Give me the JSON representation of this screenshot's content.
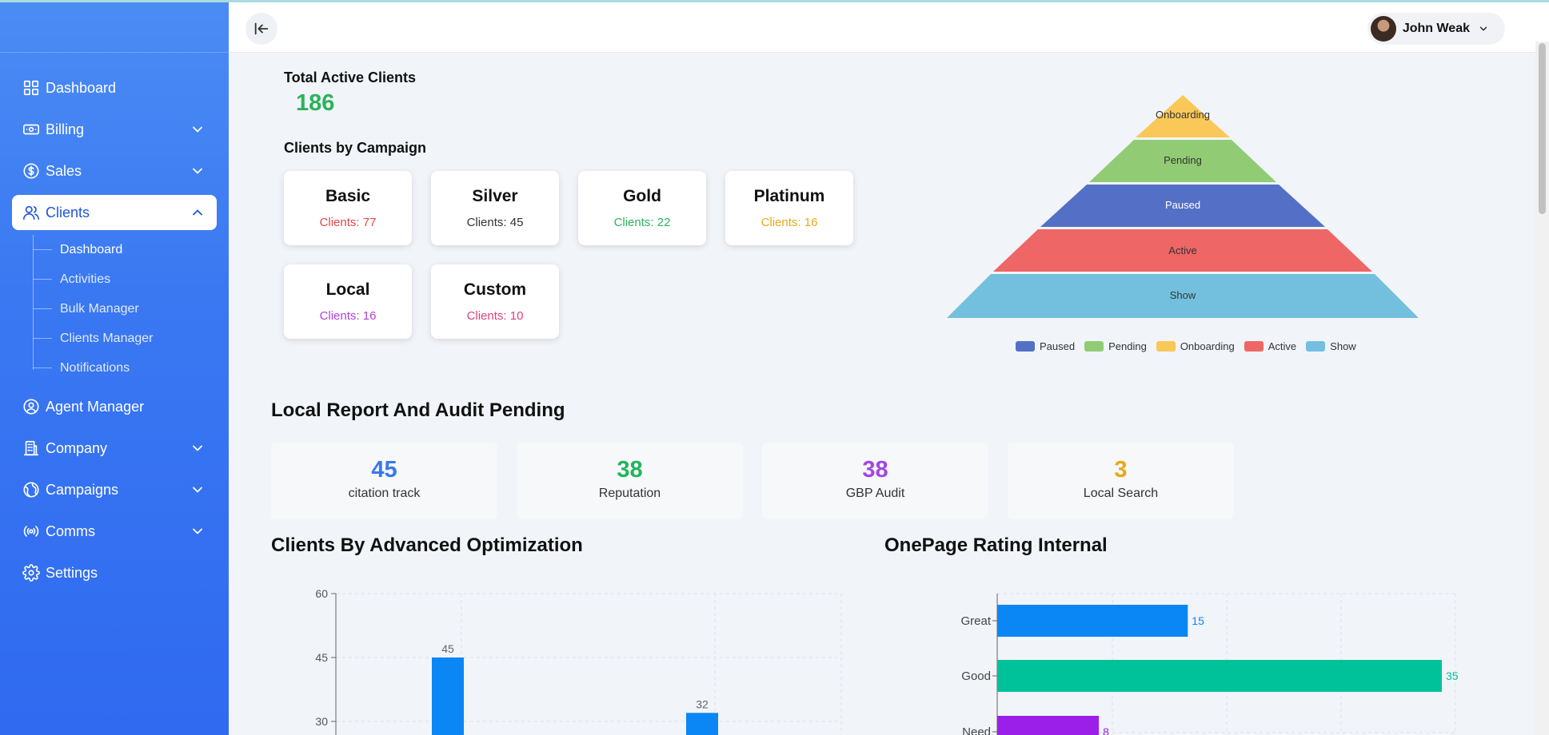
{
  "sidebar": {
    "items": [
      {
        "label": "Dashboard",
        "icon": "grid-icon",
        "expandable": false
      },
      {
        "label": "Billing",
        "icon": "cash-icon",
        "expandable": true
      },
      {
        "label": "Sales",
        "icon": "dollar-circle-icon",
        "expandable": true
      },
      {
        "label": "Clients",
        "icon": "users-icon",
        "expandable": true,
        "active": true
      },
      {
        "label": "Agent Manager",
        "icon": "user-circle-icon",
        "expandable": false
      },
      {
        "label": "Company",
        "icon": "building-icon",
        "expandable": true
      },
      {
        "label": "Campaigns",
        "icon": "globe-icon",
        "expandable": true
      },
      {
        "label": "Comms",
        "icon": "broadcast-icon",
        "expandable": true
      },
      {
        "label": "Settings",
        "icon": "gear-icon",
        "expandable": false
      }
    ],
    "clients_sub": [
      "Dashboard",
      "Activities",
      "Bulk Manager",
      "Clients Manager",
      "Notifications"
    ]
  },
  "header": {
    "user_name": "John Weak"
  },
  "summary": {
    "total_label": "Total Active Clients",
    "total_value": "186",
    "campaign_label": "Clients by Campaign"
  },
  "campaigns": [
    {
      "name": "Basic",
      "count": "Clients: 77",
      "color": "#e04848"
    },
    {
      "name": "Silver",
      "count": "Clients: 45",
      "color": "#333333"
    },
    {
      "name": "Gold",
      "count": "Clients: 22",
      "color": "#2bb35b"
    },
    {
      "name": "Platinum",
      "count": "Clients: 16",
      "color": "#e8a818"
    },
    {
      "name": "Local",
      "count": "Clients: 16",
      "color": "#b140d8"
    },
    {
      "name": "Custom",
      "count": "Clients: 10",
      "color": "#e0407c"
    }
  ],
  "pyramid": {
    "levels": [
      "Onboarding",
      "Pending",
      "Paused",
      "Active",
      "Show"
    ],
    "legend": [
      {
        "label": "Paused",
        "color": "#5470c6"
      },
      {
        "label": "Pending",
        "color": "#91cc75"
      },
      {
        "label": "Onboarding",
        "color": "#fac858"
      },
      {
        "label": "Active",
        "color": "#ee6666"
      },
      {
        "label": "Show",
        "color": "#73c0de"
      }
    ]
  },
  "local_report": {
    "title": "Local Report And Audit Pending",
    "stats": [
      {
        "value": "45",
        "label": "citation track",
        "color": "#3a78ea"
      },
      {
        "value": "38",
        "label": "Reputation",
        "color": "#22b55a"
      },
      {
        "value": "38",
        "label": "GBP Audit",
        "color": "#a246e6"
      },
      {
        "value": "3",
        "label": "Local Search",
        "color": "#e8a818"
      }
    ]
  },
  "adv_opt": {
    "title": "Clients By Advanced Optimization"
  },
  "onepage": {
    "title": "OnePage Rating Internal"
  },
  "chart_data": [
    {
      "type": "bar",
      "title": "Clients By Advanced Optimization",
      "yticks": [
        "60",
        "45",
        "30"
      ],
      "ylim": [
        0,
        60
      ],
      "values": [
        45,
        32
      ],
      "value_labels": [
        "45",
        "32"
      ],
      "color": "#0a86f5",
      "grid": true
    },
    {
      "type": "bar",
      "orientation": "horizontal",
      "title": "OnePage Rating Internal",
      "categories": [
        "Great",
        "Good",
        "Need"
      ],
      "values": [
        15,
        35,
        8
      ],
      "value_labels": [
        "15",
        "35",
        "8"
      ],
      "colors": [
        "#0a86f5",
        "#00c29a",
        "#9b1fe8"
      ],
      "grid": true
    }
  ]
}
